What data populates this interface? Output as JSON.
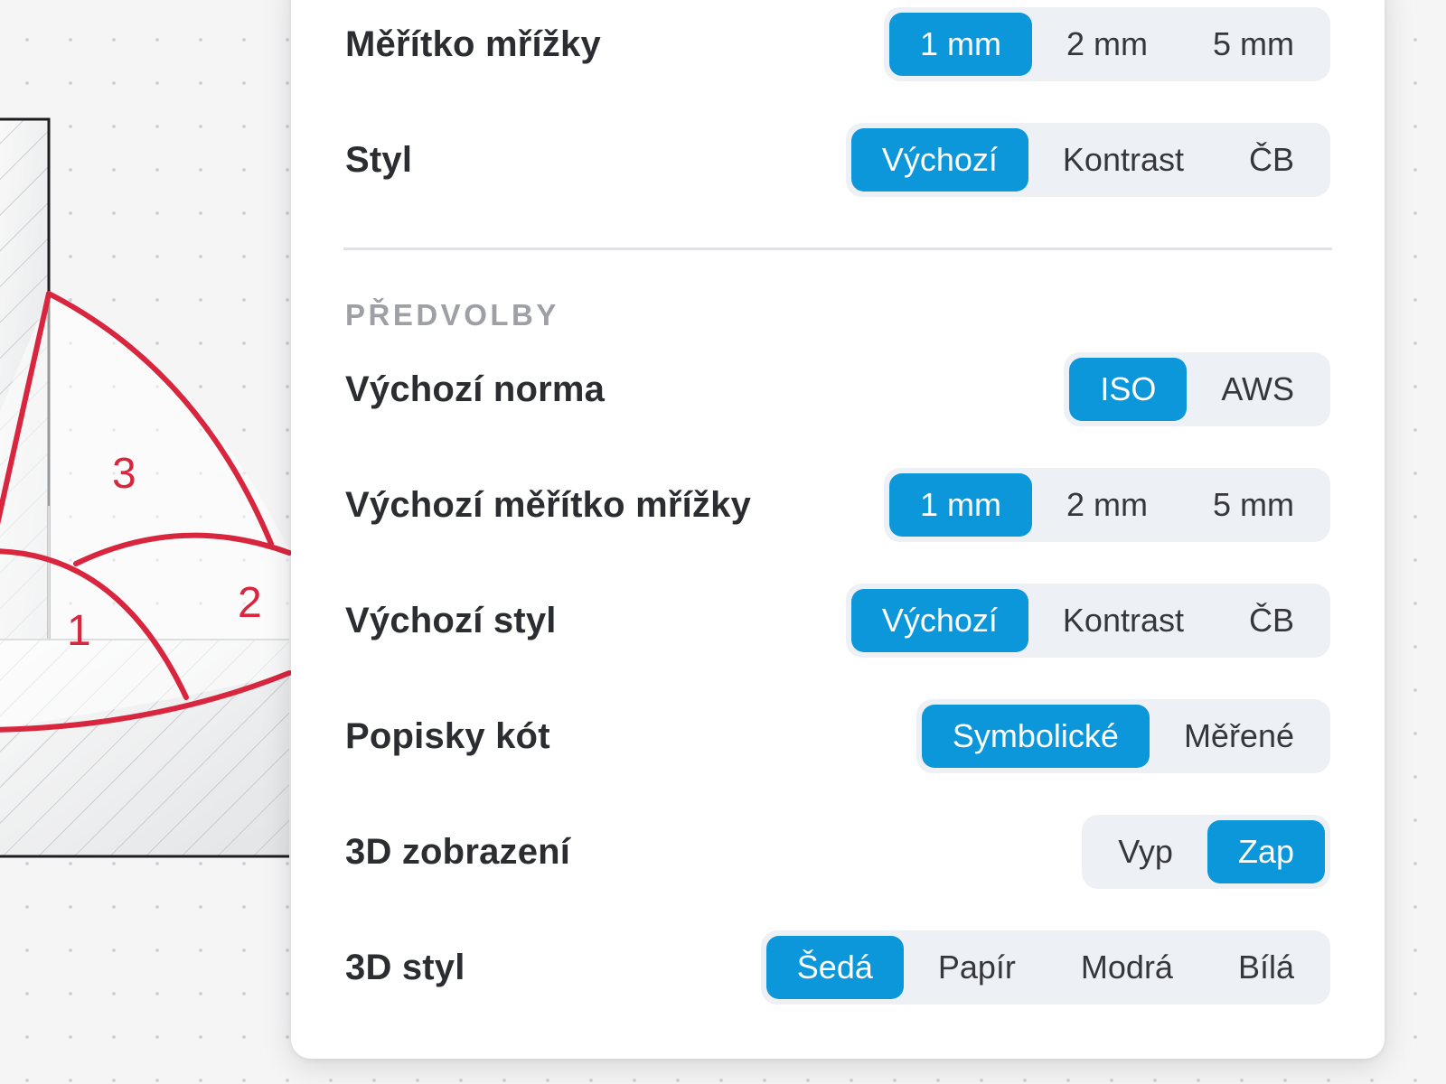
{
  "drawing": {
    "weld_passes": [
      "1",
      "2",
      "3"
    ],
    "colors": {
      "weld": "#d8263f",
      "outline": "#1d1d1f",
      "hatch": "#b9bcc2"
    }
  },
  "settings": {
    "grid_scale": {
      "label": "Měřítko mřížky",
      "options": [
        {
          "label": "1 mm",
          "selected": true
        },
        {
          "label": "2 mm",
          "selected": false
        },
        {
          "label": "5 mm",
          "selected": false
        }
      ]
    },
    "style": {
      "label": "Styl",
      "options": [
        {
          "label": "Výchozí",
          "selected": true
        },
        {
          "label": "Kontrast",
          "selected": false
        },
        {
          "label": "ČB",
          "selected": false
        }
      ]
    }
  },
  "presets": {
    "section_title": "PŘEDVOLBY",
    "default_standard": {
      "label": "Výchozí norma",
      "options": [
        {
          "label": "ISO",
          "selected": true
        },
        {
          "label": "AWS",
          "selected": false
        }
      ]
    },
    "default_grid_scale": {
      "label": "Výchozí měřítko mřížky",
      "options": [
        {
          "label": "1 mm",
          "selected": true
        },
        {
          "label": "2 mm",
          "selected": false
        },
        {
          "label": "5 mm",
          "selected": false
        }
      ]
    },
    "default_style": {
      "label": "Výchozí styl",
      "options": [
        {
          "label": "Výchozí",
          "selected": true
        },
        {
          "label": "Kontrast",
          "selected": false
        },
        {
          "label": "ČB",
          "selected": false
        }
      ]
    },
    "dimension_labels": {
      "label": "Popisky kót",
      "options": [
        {
          "label": "Symbolické",
          "selected": true
        },
        {
          "label": "Měřené",
          "selected": false
        }
      ]
    },
    "view_3d": {
      "label": "3D zobrazení",
      "options": [
        {
          "label": "Vyp",
          "selected": false
        },
        {
          "label": "Zap",
          "selected": true
        }
      ]
    },
    "style_3d": {
      "label": "3D styl",
      "options": [
        {
          "label": "Šedá",
          "selected": true
        },
        {
          "label": "Papír",
          "selected": false
        },
        {
          "label": "Modrá",
          "selected": false
        },
        {
          "label": "Bílá",
          "selected": false
        }
      ]
    }
  },
  "theme": {
    "accent": "#0b97da",
    "segment_bg": "#edf0f4",
    "text": "#2b2d31",
    "muted": "#9ea0a6"
  }
}
